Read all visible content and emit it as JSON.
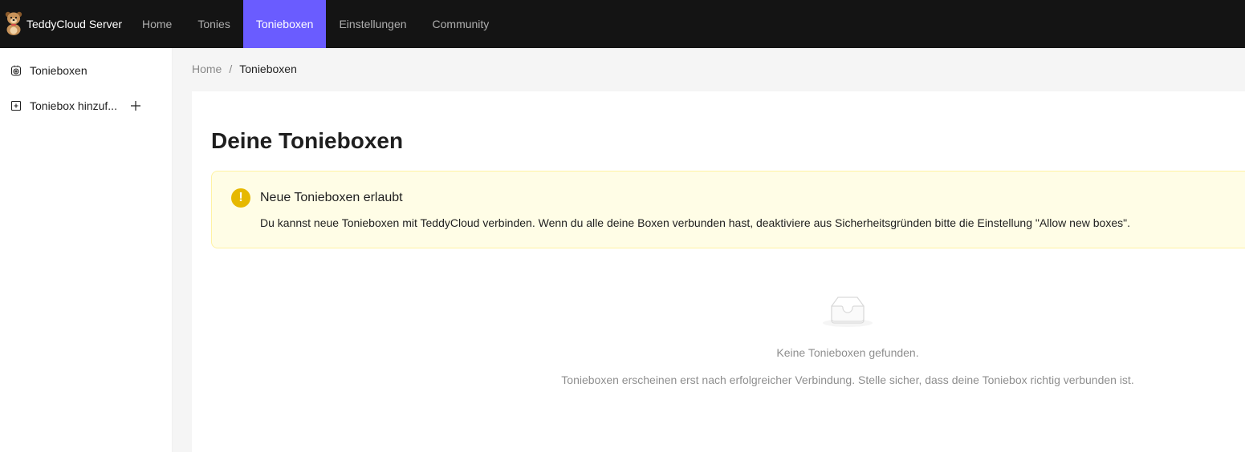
{
  "header": {
    "app_name": "TeddyCloud Server",
    "logo_icon": "teddy-bear-logo",
    "nav": [
      {
        "label": "Home",
        "active": false
      },
      {
        "label": "Tonies",
        "active": false
      },
      {
        "label": "Tonieboxen",
        "active": true
      },
      {
        "label": "Einstellungen",
        "active": false
      },
      {
        "label": "Community",
        "active": false
      }
    ],
    "active_color": "#6a5cff"
  },
  "sidebar": {
    "items": [
      {
        "label": "Tonieboxen",
        "icon": "toniebox-icon"
      },
      {
        "label": "Toniebox hinzuf...",
        "icon": "plus-square-icon",
        "action_icon": "plus-icon"
      }
    ]
  },
  "breadcrumb": {
    "items": [
      "Home",
      "Tonieboxen"
    ],
    "separator": "/"
  },
  "main": {
    "title": "Deine Tonieboxen",
    "alert": {
      "type": "warning",
      "icon": "exclamation-icon",
      "title": "Neue Tonieboxen erlaubt",
      "description": "Du kannst neue Tonieboxen mit TeddyCloud verbinden. Wenn du alle deine Boxen verbunden hast, deaktiviere aus Sicherheitsgründen bitte die Einstellung \"Allow new boxes\".",
      "color": "#e6b800",
      "background": "#fffde6"
    },
    "empty": {
      "icon": "empty-inbox-icon",
      "title": "Keine Tonieboxen gefunden.",
      "description": "Tonieboxen erscheinen erst nach erfolgreicher Verbindung. Stelle sicher, dass deine Toniebox richtig verbunden ist."
    }
  }
}
